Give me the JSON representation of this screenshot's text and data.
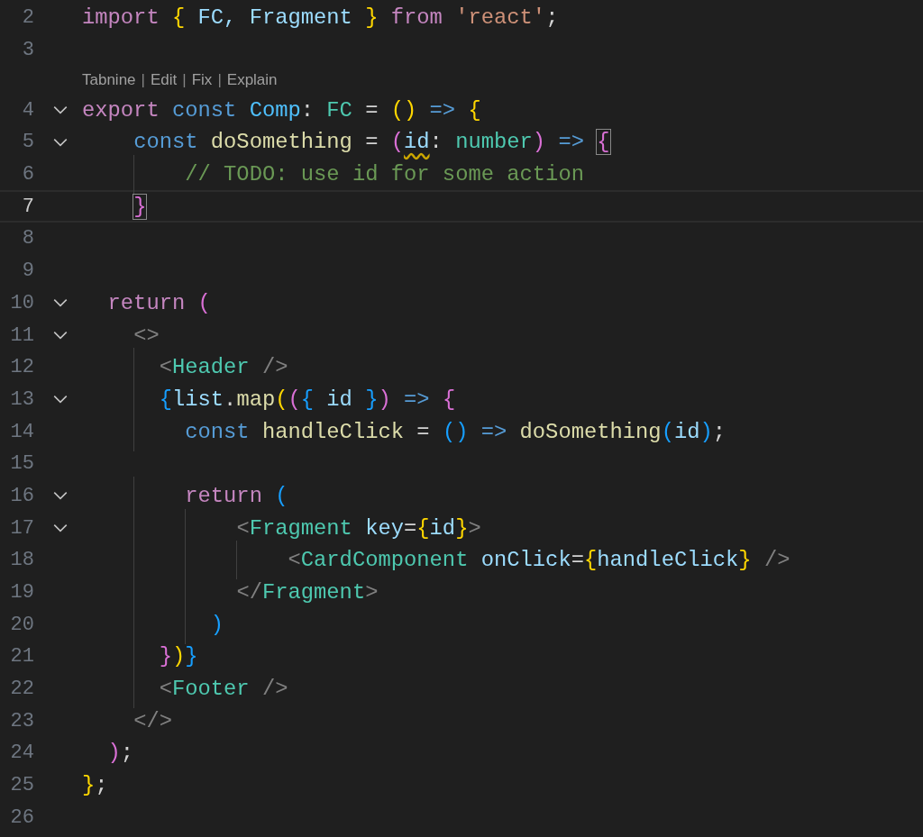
{
  "lines": [
    {
      "number": "2",
      "tokens": [
        {
          "text": "import ",
          "kind": "kw"
        },
        {
          "text": "{ ",
          "kind": "b1"
        },
        {
          "text": "FC, ",
          "kind": "var"
        },
        {
          "text": "Fragment ",
          "kind": "var"
        },
        {
          "text": "} ",
          "kind": "b1"
        },
        {
          "text": "from ",
          "kind": "kw"
        },
        {
          "text": "'react'",
          "kind": "str"
        },
        {
          "text": ";",
          "kind": "p"
        }
      ]
    },
    {
      "number": "3",
      "codelens": [
        {
          "kind": "link",
          "text": "Tabnine"
        },
        {
          "kind": "sep",
          "text": "|"
        },
        {
          "kind": "link",
          "text": "Edit"
        },
        {
          "kind": "sep",
          "text": "|"
        },
        {
          "kind": "link",
          "text": "Fix"
        },
        {
          "kind": "sep",
          "text": "|"
        },
        {
          "kind": "link",
          "text": "Explain"
        }
      ]
    },
    {
      "number": "4",
      "expanded": true,
      "tokens": [
        {
          "text": "export ",
          "kind": "kw"
        },
        {
          "text": "const ",
          "kind": "st"
        },
        {
          "text": "Comp",
          "kind": "const"
        },
        {
          "text": ": ",
          "kind": "p"
        },
        {
          "text": "FC",
          "kind": "type"
        },
        {
          "text": " = ",
          "kind": "p"
        },
        {
          "text": "() ",
          "kind": "b1"
        },
        {
          "text": "=> ",
          "kind": "st"
        },
        {
          "text": "{",
          "kind": "b1"
        }
      ]
    },
    {
      "number": "5",
      "expanded": true,
      "tokens": [
        {
          "text": "    const ",
          "kind": "st"
        },
        {
          "text": "doSomething",
          "kind": "fn"
        },
        {
          "text": " = ",
          "kind": "p"
        },
        {
          "text": "(",
          "kind": "b2"
        },
        {
          "text": "id",
          "kind": "var",
          "squiggle": true
        },
        {
          "text": ": ",
          "kind": "p"
        },
        {
          "text": "number",
          "kind": "type"
        },
        {
          "text": ") ",
          "kind": "b2"
        },
        {
          "text": "=> ",
          "kind": "st"
        },
        {
          "text": "{",
          "kind": "b2",
          "match": true
        }
      ]
    },
    {
      "number": "6",
      "tokens": [
        {
          "text": "        // TODO: use id for some action",
          "kind": "cm"
        }
      ]
    },
    {
      "number": "7",
      "current": true,
      "tokens": [
        {
          "text": "    }",
          "kind": "b2",
          "match": true
        }
      ]
    },
    {
      "number": "8"
    },
    {
      "number": "9"
    },
    {
      "number": "10",
      "expanded": true,
      "tokens": [
        {
          "text": "  return ",
          "kind": "kw"
        },
        {
          "text": "(",
          "kind": "b2"
        }
      ]
    },
    {
      "number": "11",
      "expanded": true,
      "tokens": [
        {
          "text": "    <>",
          "kind": "tp"
        }
      ]
    },
    {
      "number": "12",
      "tokens": [
        {
          "text": "      <",
          "kind": "tp"
        },
        {
          "text": "Header ",
          "kind": "tag"
        },
        {
          "text": "/>",
          "kind": "tp"
        }
      ]
    },
    {
      "number": "13",
      "expanded": true,
      "tokens": [
        {
          "text": "      {",
          "kind": "b3"
        },
        {
          "text": "list",
          "kind": "var"
        },
        {
          "text": ".",
          "kind": "p"
        },
        {
          "text": "map",
          "kind": "fn"
        },
        {
          "text": "(",
          "kind": "b1"
        },
        {
          "text": "(",
          "kind": "b2"
        },
        {
          "text": "{ ",
          "kind": "b3"
        },
        {
          "text": "id ",
          "kind": "var"
        },
        {
          "text": "}",
          "kind": "b3"
        },
        {
          "text": ") ",
          "kind": "b2"
        },
        {
          "text": "=> ",
          "kind": "st"
        },
        {
          "text": "{",
          "kind": "b2"
        }
      ]
    },
    {
      "number": "14",
      "tokens": [
        {
          "text": "        const ",
          "kind": "st"
        },
        {
          "text": "handleClick",
          "kind": "fn"
        },
        {
          "text": " = ",
          "kind": "p"
        },
        {
          "text": "() ",
          "kind": "b3"
        },
        {
          "text": "=> ",
          "kind": "st"
        },
        {
          "text": "doSomething",
          "kind": "fn"
        },
        {
          "text": "(",
          "kind": "b3"
        },
        {
          "text": "id",
          "kind": "var"
        },
        {
          "text": ")",
          "kind": "b3"
        },
        {
          "text": ";",
          "kind": "p"
        }
      ]
    },
    {
      "number": "15"
    },
    {
      "number": "16",
      "expanded": true,
      "tokens": [
        {
          "text": "        return ",
          "kind": "kw"
        },
        {
          "text": "(",
          "kind": "b3"
        }
      ]
    },
    {
      "number": "17",
      "expanded": true,
      "tokens": [
        {
          "text": "            <",
          "kind": "tp"
        },
        {
          "text": "Fragment ",
          "kind": "tag"
        },
        {
          "text": "key",
          "kind": "attr"
        },
        {
          "text": "=",
          "kind": "p"
        },
        {
          "text": "{",
          "kind": "b1"
        },
        {
          "text": "id",
          "kind": "var"
        },
        {
          "text": "}",
          "kind": "b1"
        },
        {
          "text": ">",
          "kind": "tp"
        }
      ]
    },
    {
      "number": "18",
      "tokens": [
        {
          "text": "                <",
          "kind": "tp"
        },
        {
          "text": "CardComponent ",
          "kind": "tag"
        },
        {
          "text": "onClick",
          "kind": "attr"
        },
        {
          "text": "=",
          "kind": "p"
        },
        {
          "text": "{",
          "kind": "b1"
        },
        {
          "text": "handleClick",
          "kind": "var"
        },
        {
          "text": "} ",
          "kind": "b1"
        },
        {
          "text": "/>",
          "kind": "tp"
        }
      ]
    },
    {
      "number": "19",
      "tokens": [
        {
          "text": "            </",
          "kind": "tp"
        },
        {
          "text": "Fragment",
          "kind": "tag"
        },
        {
          "text": ">",
          "kind": "tp"
        }
      ]
    },
    {
      "number": "20",
      "tokens": [
        {
          "text": "          )",
          "kind": "b3"
        }
      ]
    },
    {
      "number": "21",
      "tokens": [
        {
          "text": "      }",
          "kind": "b2"
        },
        {
          "text": ")",
          "kind": "b1"
        },
        {
          "text": "}",
          "kind": "b3"
        }
      ]
    },
    {
      "number": "22",
      "tokens": [
        {
          "text": "      <",
          "kind": "tp"
        },
        {
          "text": "Footer ",
          "kind": "tag"
        },
        {
          "text": "/>",
          "kind": "tp"
        }
      ]
    },
    {
      "number": "23",
      "tokens": [
        {
          "text": "    </>",
          "kind": "tp"
        }
      ]
    },
    {
      "number": "24",
      "tokens": [
        {
          "text": "  )",
          "kind": "b2"
        },
        {
          "text": ";",
          "kind": "p"
        }
      ]
    },
    {
      "number": "25",
      "tokens": [
        {
          "text": "}",
          "kind": "b1"
        },
        {
          "text": ";",
          "kind": "p"
        }
      ]
    },
    {
      "number": "26"
    }
  ]
}
